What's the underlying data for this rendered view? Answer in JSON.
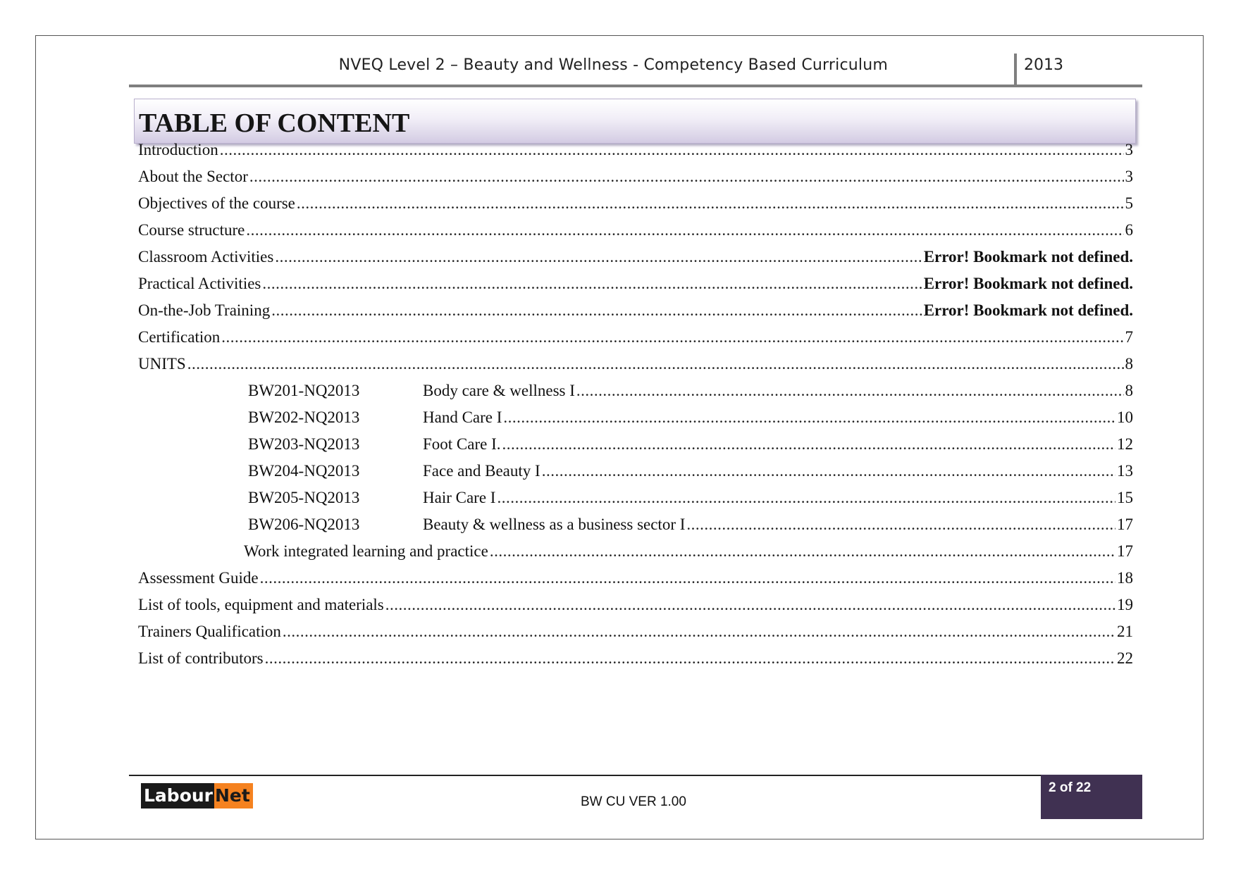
{
  "header": {
    "title": "NVEQ Level 2 – Beauty and Wellness - Competency Based Curriculum",
    "year": "2013"
  },
  "toc": {
    "heading": "TABLE OF CONTENT",
    "entries": [
      {
        "title": "Introduction",
        "page": "3"
      },
      {
        "title": "About the Sector",
        "page": "3"
      },
      {
        "title": "Objectives of the course",
        "page": "5"
      },
      {
        "title": "Course structure",
        "page": "6"
      },
      {
        "title": "Classroom Activities",
        "page": "Error! Bookmark not defined."
      },
      {
        "title": "Practical Activities",
        "page": "Error! Bookmark not defined."
      },
      {
        "title": "On-the-Job Training",
        "page": "Error! Bookmark not defined."
      },
      {
        "title": "Certification",
        "page": "7"
      },
      {
        "title": "UNITS",
        "page": "8"
      },
      {
        "code": "BW201-NQ2013",
        "title": "Body care & wellness I",
        "page": "8"
      },
      {
        "code": "BW202-NQ2013",
        "title": "Hand Care I",
        "page": "10"
      },
      {
        "code": "BW203-NQ2013",
        "title": "Foot Care I.",
        "page": "12"
      },
      {
        "code": "BW204-NQ2013",
        "title": "Face and Beauty I",
        "page": "13"
      },
      {
        "code": "BW205-NQ2013",
        "title": "Hair Care I",
        "page": "15"
      },
      {
        "code": "BW206-NQ2013",
        "title": "Beauty & wellness as a business sector I",
        "page": "17"
      },
      {
        "title": "Work integrated learning and practice",
        "page": "17"
      },
      {
        "title": "Assessment Guide",
        "page": "18"
      },
      {
        "title": "List of tools, equipment and materials",
        "page": "19"
      },
      {
        "title": "Trainers Qualification",
        "page": "21"
      },
      {
        "title": "List of contributors",
        "page": "22"
      }
    ]
  },
  "footer": {
    "logo_part_a": "Labour",
    "logo_part_b": "Net",
    "version": "BW CU VER 1.00",
    "page_indicator": "2 of 22",
    "badge_color": "#403152",
    "logo_accent_color": "#f58220"
  }
}
